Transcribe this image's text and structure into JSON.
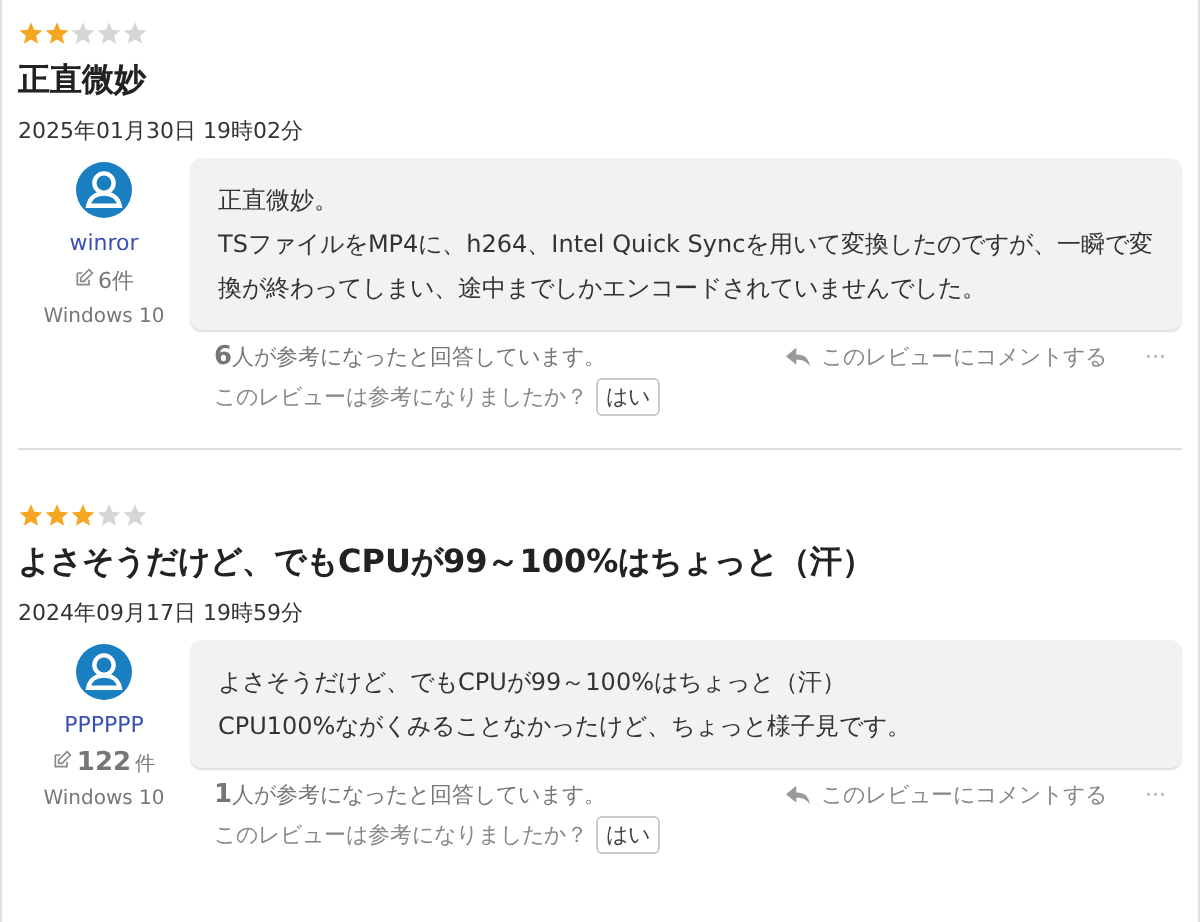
{
  "reviews": [
    {
      "stars": 2,
      "title": "正直微妙",
      "date": "2025年01月30日 19時02分",
      "user": {
        "name": "winror",
        "review_count": "6件",
        "os": "Windows 10"
      },
      "body": [
        "正直微妙。",
        "TSファイルをMP4に、h264、Intel Quick Syncを用いて変換したのですが、一瞬で変換が終わってしまい、途中までしかエンコードされていませんでした。"
      ],
      "helpful": "**6**人が参考になったと回答しています。",
      "comment_link": "このレビューにコメントする",
      "more": "···",
      "question": "このレビューは参考になりましたか？",
      "yes_button": "はい"
    },
    {
      "stars": 3,
      "title": "よさそうだけど、でもCPUが99～100%はちょっと（汗）",
      "date": "2024年09月17日 19時59分",
      "user": {
        "name": "PPPPPP",
        "review_count": "122",
        "review_count_unit": "件",
        "os": "Windows 10"
      },
      "body": [
        "よさそうだけど、でもCPUが99～100%はちょっと（汗）",
        "CPU100%ながくみることなかったけど、ちょっと様子見です。"
      ],
      "helpful": "**1**人が参考になったと回答しています。",
      "comment_link": "このレビューにコメントする",
      "more": "···",
      "question": "このレビューは参考になりましたか？",
      "yes_button": "はい"
    }
  ]
}
